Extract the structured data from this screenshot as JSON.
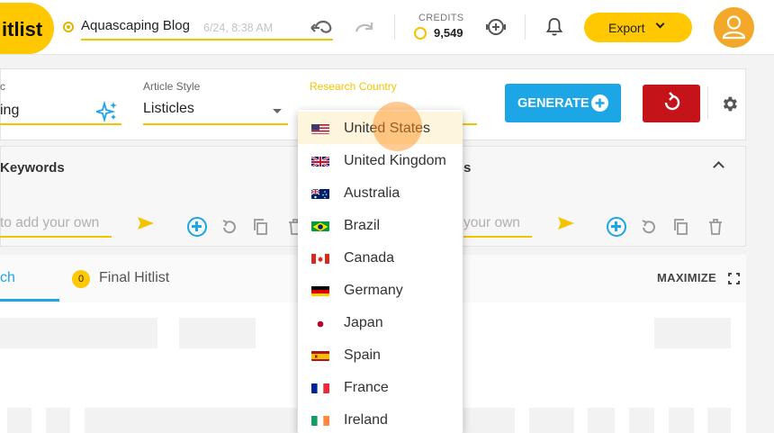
{
  "app": {
    "logo_text": "itlist"
  },
  "header": {
    "project_title": "Aquascaping Blog",
    "timestamp": "6/24, 8:38 AM",
    "credits_label": "CREDITS",
    "credits_value": "9,549",
    "export_label": "Export"
  },
  "settings": {
    "left_field_label": "c",
    "left_field_value": "ing",
    "article_style_label": "Article Style",
    "article_style_value": "Listicles",
    "research_country_label": "Research Country",
    "generate_label": "GENERATE"
  },
  "keywords": {
    "title": "Keywords",
    "left_placeholder": "to add your own",
    "right_title_fragment": "s",
    "right_placeholder": "your own"
  },
  "tabs": {
    "search_fragment": "ch",
    "final_hitlist_label": "Final Hitlist",
    "final_hitlist_count": "0",
    "maximize_label": "MAXIMIZE"
  },
  "country_dropdown": {
    "selected": "United States",
    "options": [
      {
        "label": "United States",
        "flag": "us"
      },
      {
        "label": "United Kingdom",
        "flag": "uk"
      },
      {
        "label": "Australia",
        "flag": "au"
      },
      {
        "label": "Brazil",
        "flag": "br"
      },
      {
        "label": "Canada",
        "flag": "ca"
      },
      {
        "label": "Germany",
        "flag": "de"
      },
      {
        "label": "Japan",
        "flag": "jp"
      },
      {
        "label": "Spain",
        "flag": "es"
      },
      {
        "label": "France",
        "flag": "fr"
      },
      {
        "label": "Ireland",
        "flag": "ie"
      }
    ]
  },
  "colors": {
    "brand_yellow": "#ffc800",
    "accent_blue": "#1da6e6",
    "reset_red": "#c4141a",
    "avatar_orange": "#f4a82a"
  }
}
